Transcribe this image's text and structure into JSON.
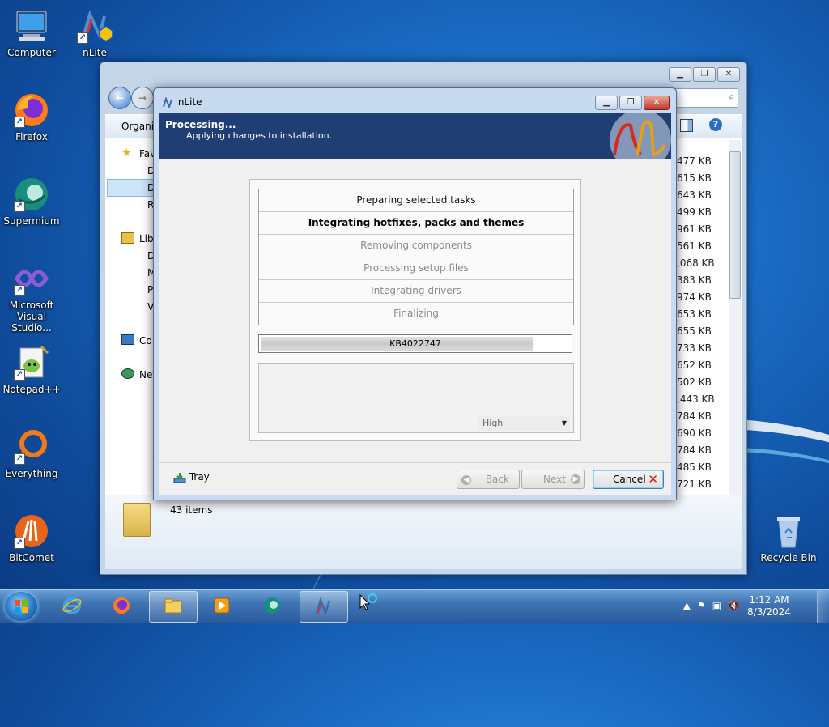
{
  "desktop": {
    "icons": [
      {
        "label": "Computer"
      },
      {
        "label": "nLite"
      },
      {
        "label": "Firefox"
      },
      {
        "label": "Supermium"
      },
      {
        "label": "Microsoft Visual Studio..."
      },
      {
        "label": "Notepad++"
      },
      {
        "label": "Everything"
      },
      {
        "label": "BitComet"
      },
      {
        "label": "Recycle Bin"
      }
    ]
  },
  "explorer": {
    "toolbar_organize": "Organiz",
    "nav": [
      "Fav",
      "D",
      "D",
      "R",
      "Lib",
      "D",
      "M",
      "P",
      "V",
      "Co",
      "Net"
    ],
    "sizes": [
      "477 KB",
      "615 KB",
      "643 KB",
      "499 KB",
      "961 KB",
      "561 KB",
      ",068 KB",
      "383 KB",
      "974 KB",
      "653 KB",
      "655 KB",
      "733 KB",
      "652 KB",
      "502 KB",
      ",443 KB",
      "784 KB",
      "690 KB",
      "784 KB",
      "485 KB",
      "721 KB"
    ],
    "status_count": "43 items"
  },
  "dialog": {
    "title": "nLite",
    "header_title": "Processing...",
    "header_subtitle": "Applying changes to installation.",
    "steps": [
      {
        "label": "Preparing selected tasks",
        "state": "done"
      },
      {
        "label": "Integrating hotfixes, packs and themes",
        "state": "active"
      },
      {
        "label": "Removing components",
        "state": "pending"
      },
      {
        "label": "Processing setup files",
        "state": "pending"
      },
      {
        "label": "Integrating drivers",
        "state": "pending"
      },
      {
        "label": "Finalizing",
        "state": "pending"
      }
    ],
    "progress": {
      "text": "KB4022747",
      "percent": 88
    },
    "priority": "High",
    "footer": {
      "tray_label": "Tray",
      "back_label": "Back",
      "next_label": "Next",
      "cancel_label": "Cancel"
    }
  },
  "taskbar": {
    "time": "1:12 AM",
    "date": "8/3/2024"
  },
  "colors": {
    "dialog_header": "#1f3e73",
    "taskbar": "#3f74b5",
    "cancel_x": "#d01818"
  }
}
